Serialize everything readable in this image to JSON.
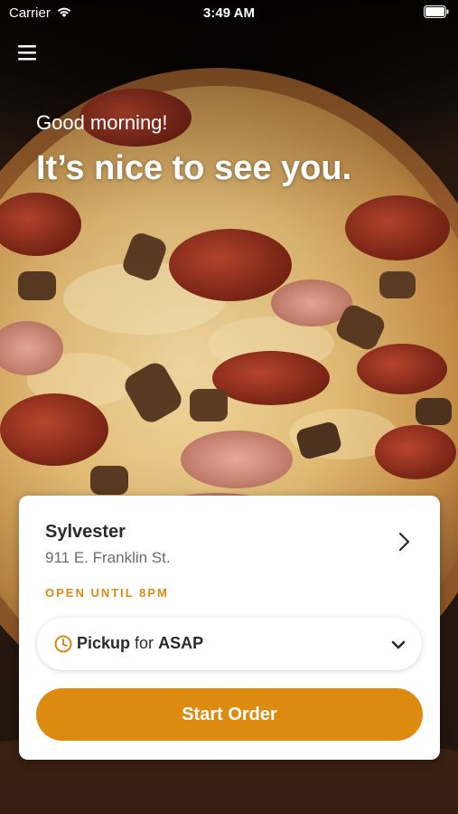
{
  "status_bar": {
    "carrier": "Carrier",
    "time": "3:49 AM"
  },
  "header": {
    "menu_icon": "hamburger-menu-icon"
  },
  "hero": {
    "greeting": "Good morning!",
    "headline": "It’s nice to see you.",
    "background_image": "pizza"
  },
  "store": {
    "name": "Sylvester",
    "address": "911 E. Franklin St.",
    "hours": "OPEN UNTIL 8PM"
  },
  "order_mode": {
    "icon": "clock-icon",
    "method": "Pickup",
    "connector": "for",
    "time": "ASAP"
  },
  "actions": {
    "start_order": "Start Order"
  },
  "colors": {
    "accent": "#DD8A10",
    "hours_text": "#DB8A12",
    "card_bg": "#FFFFFF"
  }
}
